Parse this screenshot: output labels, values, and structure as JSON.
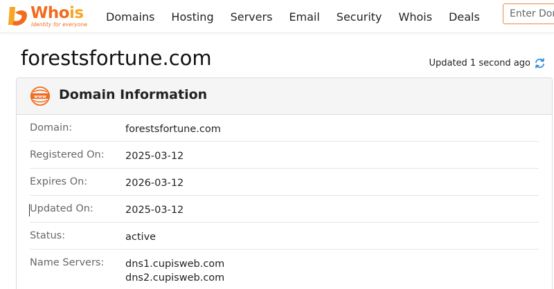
{
  "header": {
    "logo": {
      "word_part1": "Who",
      "word_part2": "is",
      "tagline": "Identity for everyone"
    },
    "nav": [
      {
        "label": "Domains"
      },
      {
        "label": "Hosting"
      },
      {
        "label": "Servers"
      },
      {
        "label": "Email"
      },
      {
        "label": "Security"
      },
      {
        "label": "Whois"
      },
      {
        "label": "Deals"
      }
    ],
    "search": {
      "placeholder": "Enter Domain or IP"
    }
  },
  "page": {
    "title": "forestsfortune.com",
    "updated_text": "Updated 1 second ago"
  },
  "panel": {
    "title": "Domain Information",
    "rows": [
      {
        "label": "Domain:",
        "value": "forestsfortune.com"
      },
      {
        "label": "Registered On:",
        "value": "2025-03-12"
      },
      {
        "label": "Expires On:",
        "value": "2026-03-12"
      },
      {
        "label": "Updated On:",
        "value": "2025-03-12"
      },
      {
        "label": "Status:",
        "value": "active"
      },
      {
        "label": "Name Servers:",
        "values": [
          "dns1.cupisweb.com",
          "dns2.cupisweb.com"
        ]
      }
    ]
  },
  "icons": {
    "logo": "whois-logo-icon",
    "refresh": "refresh-icon",
    "www": "www-globe-icon"
  },
  "colors": {
    "brand_orange": "#f26b1d",
    "brand_yellow": "#f6a623",
    "refresh_blue": "#2a8ad9"
  }
}
